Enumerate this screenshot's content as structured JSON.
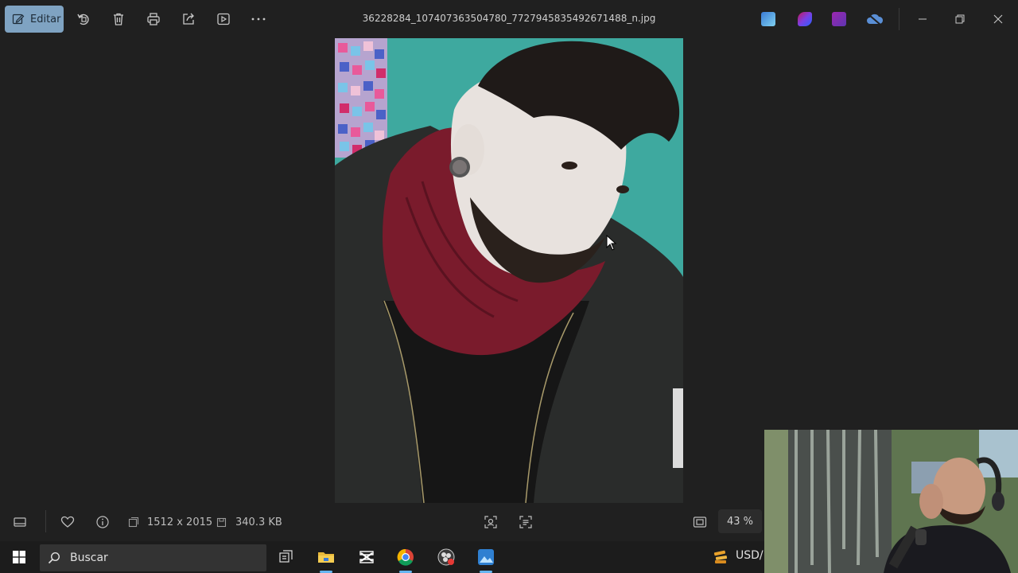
{
  "toolbar": {
    "edit_label": "Editar",
    "title": "36228284_107407363504780_7727945835492671488_n.jpg"
  },
  "status": {
    "dimensions": "1512 x 2015",
    "filesize": "340.3 KB",
    "zoom": "43 %"
  },
  "taskbar": {
    "search_placeholder": "Buscar",
    "ticker": "USD/"
  },
  "icons": {
    "edit": "edit-icon",
    "rotate": "rotate-icon",
    "delete": "trash-icon",
    "print": "print-icon",
    "share": "share-icon",
    "slideshow": "slideshow-icon",
    "more": "more-icon",
    "filmstrip": "filmstrip-icon",
    "favorite": "heart-icon",
    "info": "info-icon",
    "dimensions": "dimensions-icon",
    "filesize": "save-icon",
    "face": "face-detect-icon",
    "text": "text-detect-icon",
    "fit": "fit-to-window-icon",
    "windows": "windows-logo-icon",
    "search": "search-icon"
  },
  "colors": {
    "accent": "#7fa3c2",
    "background": "#202020",
    "taskbar": "#1c1c1c",
    "active_indicator": "#66b5f0"
  }
}
